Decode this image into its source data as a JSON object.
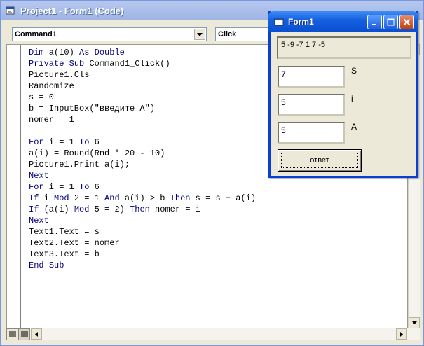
{
  "code_window": {
    "title": "Project1 - Form1 (Code)",
    "object_combo": "Command1",
    "procedure_combo": "Click",
    "lines": [
      "Dim a(10) As Double",
      "Private Sub Command1_Click()",
      "Picture1.Cls",
      "Randomize",
      "s = 0",
      "b = InputBox(\"введите A\")",
      "nomer = 1",
      "",
      "For i = 1 To 6",
      "a(i) = Round(Rnd * 20 - 10)",
      "Picture1.Print a(i);",
      "Next",
      "For i = 1 To 6",
      "If i Mod 2 = 1 And a(i) > b Then s = s + a(i)",
      "If (a(i) Mod 5 = 2) Then nomer = i",
      "Next",
      "Text1.Text = s",
      "Text2.Text = nomer",
      "Text3.Text = b",
      "End Sub"
    ]
  },
  "form_window": {
    "title": "Form1",
    "picture_output": "5 -9 -7  1  7 -5",
    "text1_value": "7",
    "text1_label": "S",
    "text2_value": "5",
    "text2_label": "i",
    "text3_value": "5",
    "text3_label": "A",
    "button_label": "ответ"
  }
}
